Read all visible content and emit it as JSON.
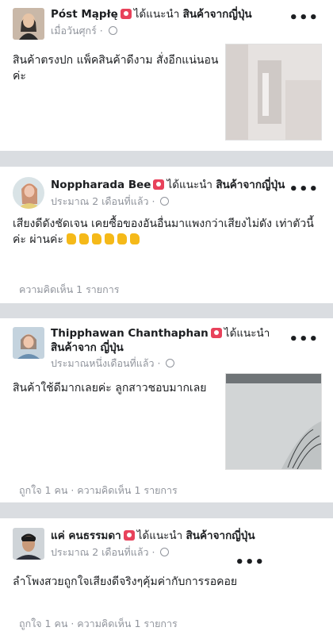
{
  "posts": [
    {
      "author": "Póst Mąpłę",
      "recommends": "ได้แนะนำ",
      "page": "สินค้าจากญี่ปุ่น",
      "time": "เมื่อวันศุกร์",
      "text": "สินค้าตรงปก แพ็คสินค้าดีงาม สั่งอีกแน่นอน ค่ะ",
      "footer": ""
    },
    {
      "author": "Noppharada Bee",
      "recommends": "ได้แนะนำ",
      "page": "สินค้าจากญี่ปุ่น",
      "time": "ประมาณ 2 เดือนที่แล้ว",
      "text": "เสียงดีดังชัดเจน เคยซื้อของอันอื่นมาแพงกว่าเสียงไม่ดัง เท่าตัวนี้ ค่ะ ผ่านค่ะ",
      "thumbs_count": 6,
      "footer": "ความคิดเห็น 1 รายการ"
    },
    {
      "author": "Thipphawan Chanthaphan",
      "recommends": "ได้แนะนำ",
      "page": "สินค้าจาก ญี่ปุ่น",
      "time": "ประมาณหนึ่งเดือนที่แล้ว",
      "text": "สินค้าใช้ดีมากเลยค่ะ ลูกสาวชอบมากเลย",
      "footer": "ถูกใจ 1 คน · ความคิดเห็น 1 รายการ"
    },
    {
      "author": "แค่ คนธรรมดา",
      "recommends": "ได้แนะนำ",
      "page": "สินค้าจากญี่ปุ่น",
      "time": "ประมาณ 2 เดือนที่แล้ว",
      "text": "ลำโพงสวยถูกใจเสียงดีจริงๆคุ้มค่ากับการรอคอย",
      "footer": "ถูกใจ 1 คน · ความคิดเห็น 1 รายการ"
    }
  ],
  "icons": {
    "recommend": "recommend-icon",
    "audience": "globe-icon",
    "menu": "more-options-icon",
    "emoji": "thumbs-up-emoji"
  },
  "colors": {
    "recommend_icon": "#e8425b",
    "meta_text": "#90949c",
    "separator": "#dadde1"
  },
  "more_glyph": "•••"
}
